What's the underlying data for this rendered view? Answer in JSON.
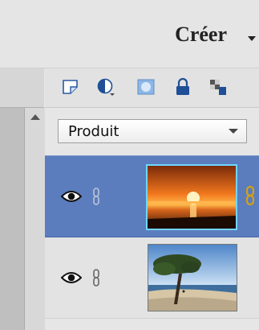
{
  "header": {
    "create_label": "Créer"
  },
  "toolbar": {
    "icons": [
      "new-layer-icon",
      "adjustment-layer-icon",
      "add-mask-icon",
      "lock-icon",
      "lock-transparency-icon"
    ]
  },
  "blend_mode": {
    "selected": "Produit"
  },
  "layers": [
    {
      "name": "sunset",
      "visible": true,
      "selected": true
    },
    {
      "name": "beach",
      "visible": true,
      "selected": false
    }
  ],
  "colors": {
    "selected_layer": "#5b7dbd",
    "panel_bg": "#e3e3e3",
    "thumb_highlight": "#6fd6ff",
    "lock_gold": "#d4a017"
  }
}
